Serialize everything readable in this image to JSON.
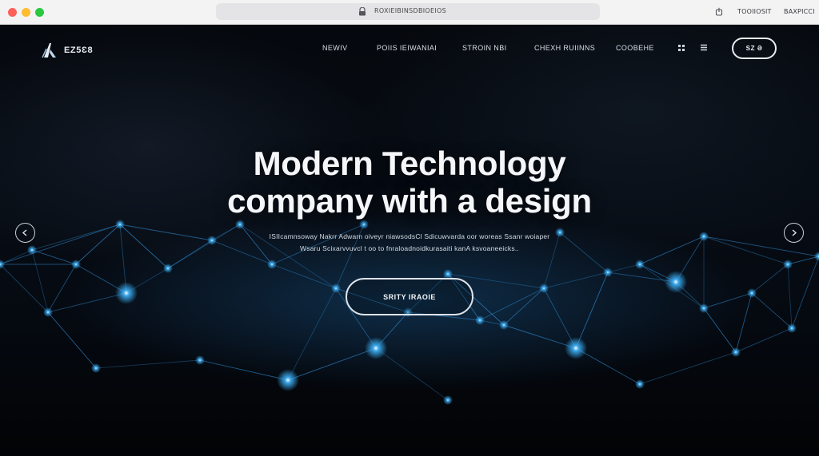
{
  "browser": {
    "url": "ROXIEIBINSDBIOEIOS",
    "links": [
      "TOOIIOSIT",
      "BAXPICCI"
    ],
    "icons": {
      "lock": "lock-icon",
      "extension": "share-icon"
    }
  },
  "header": {
    "logo_text": "EZ5Ɛ8",
    "nav": [
      "NEWIV",
      "POIIS IEIWANIAI",
      "STROIN NBI",
      "CHEXH RUIINNS",
      "COOBEHE"
    ],
    "icons": [
      "grid-icon",
      "menu-icon"
    ],
    "cta_label": "SZ Ə"
  },
  "hero": {
    "title_line1": "Modern Technology",
    "title_line2": "company with a design",
    "subtitle_line1": "ISIIcamnsoway Nakrr Adwarn oiveyr niawsodsCl Sdicuwvarda oor woreas Ssanr woiaper",
    "subtitle_line2": "Wsaru Scixarvvuvcl t oo to fnraloadnoidkurasaiti kanA ksvoaneeicks..",
    "cta_label": "SRITY IRAOIE",
    "prev_icon": "arrow-left-icon",
    "next_icon": "arrow-right-icon"
  },
  "colors": {
    "background": "#05080d",
    "accent_glow": "#3fb6ff",
    "network_line": "#2f8fd6",
    "text": "#f4f6f9"
  }
}
